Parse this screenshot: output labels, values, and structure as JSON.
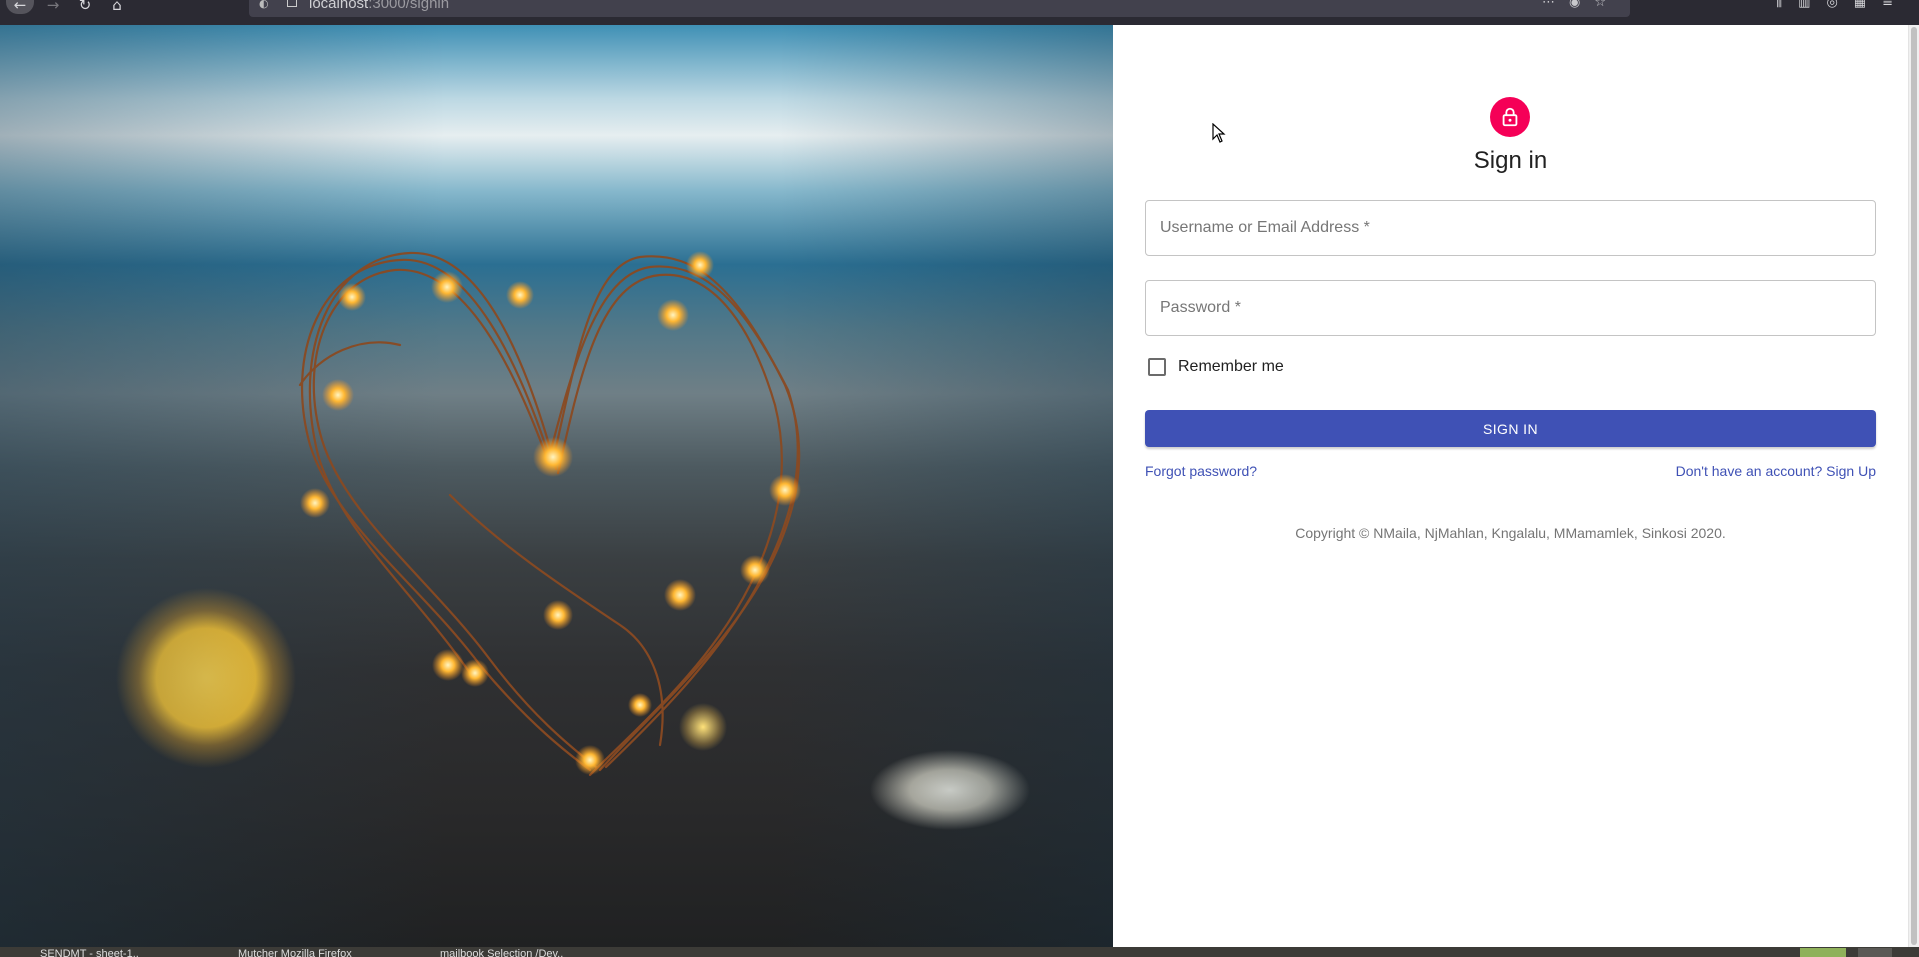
{
  "browser": {
    "url_host": "localhost",
    "url_path": ":3000/signin",
    "icons": [
      "back-icon",
      "forward-icon",
      "reload-icon",
      "home-icon",
      "shield-icon",
      "lock-icon",
      "more-icon",
      "pocket-icon",
      "bookmark-star-icon",
      "library-icon",
      "sidebar-icon",
      "account-icon",
      "extensions-icon",
      "menu-icon"
    ]
  },
  "hero": {
    "image_alt": "Heart-shaped string of fairy lights on a beach at dusk"
  },
  "signin": {
    "avatar_icon": "lock-icon",
    "avatar_color": "#f50057",
    "title": "Sign in",
    "username_placeholder": "Username or Email Address *",
    "password_placeholder": "Password *",
    "remember_label": "Remember me",
    "remember_checked": false,
    "submit_label": "SIGN IN",
    "forgot_link": "Forgot password?",
    "signup_link": "Don't have an account? Sign Up",
    "copyright": "Copyright © NMaila, NjMahlan, Kngalalu, MMamamlek, Sinkosi 2020.",
    "primary_color": "#3f51b5"
  },
  "taskbar": {
    "items": [
      "SENDMT - sheet-1..",
      "Mutcher Mozilla Firefox",
      "mailbook Selection /Dev.."
    ]
  }
}
